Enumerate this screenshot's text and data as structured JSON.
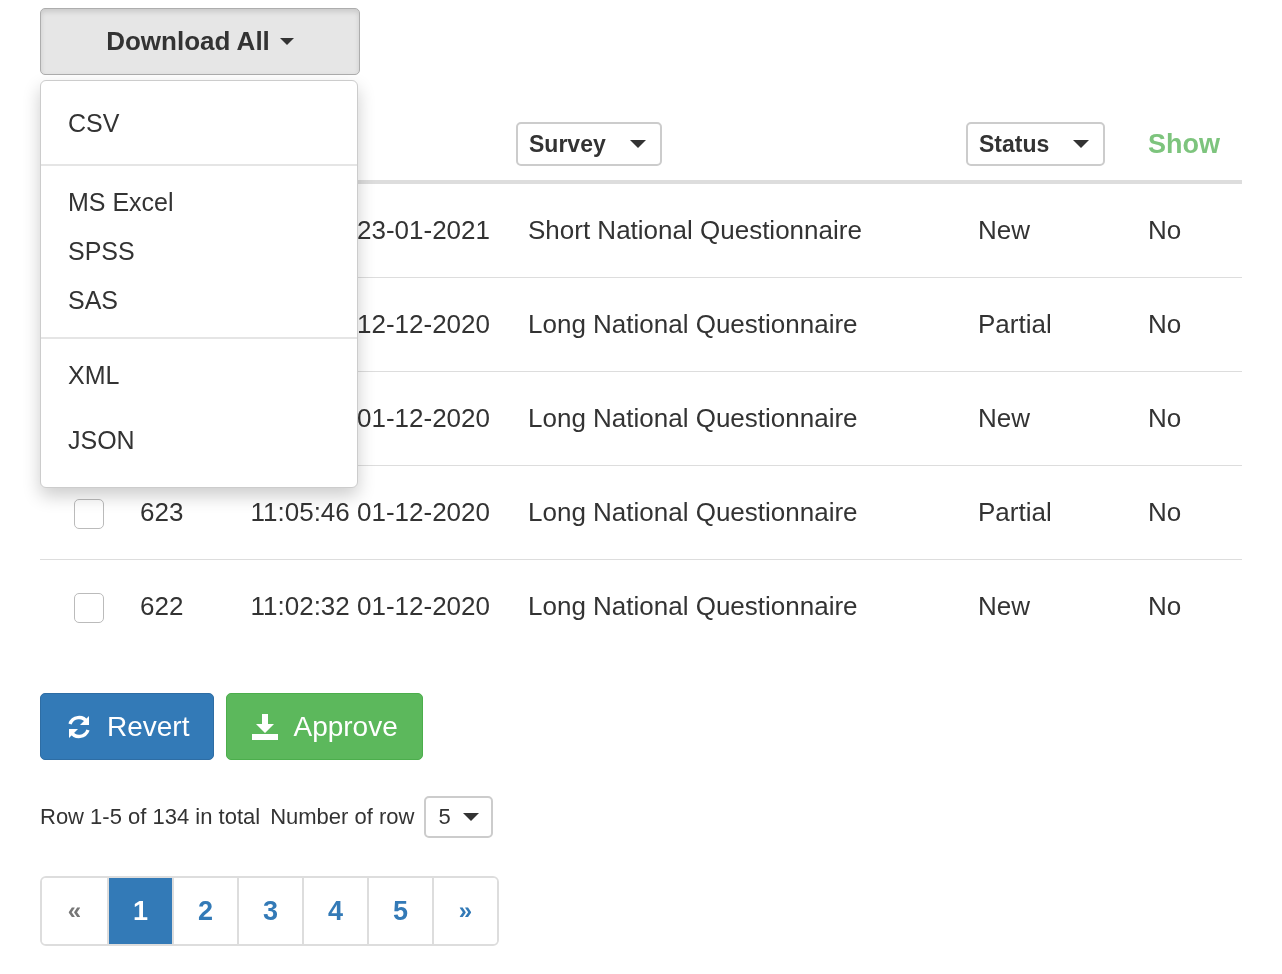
{
  "download_button": {
    "label": "Download All",
    "expanded": true
  },
  "download_menu": {
    "groups": [
      [
        "CSV"
      ],
      [
        "MS Excel",
        "SPSS",
        "SAS"
      ],
      [
        "XML",
        "JSON"
      ]
    ]
  },
  "table": {
    "headers": [
      {
        "kind": "dropdown",
        "label": "Survey"
      },
      {
        "kind": "dropdown",
        "label": "Status"
      },
      {
        "kind": "text",
        "label": "Show"
      }
    ],
    "rows": [
      {
        "datetime": "23-01-2021",
        "survey": "Short National Questionnaire",
        "status": "New",
        "show": "No"
      },
      {
        "datetime": "12-12-2020",
        "survey": "Long National Questionnaire",
        "status": "Partial",
        "show": "No"
      },
      {
        "datetime": "01-12-2020",
        "survey": "Long National Questionnaire",
        "status": "New",
        "show": "No"
      },
      {
        "checked": false,
        "id": "623",
        "datetime": "11:05:46 01-12-2020",
        "survey": "Long National Questionnaire",
        "status": "Partial",
        "show": "No"
      },
      {
        "checked": false,
        "id": "622",
        "datetime": "11:02:32 01-12-2020",
        "survey": "Long National Questionnaire",
        "status": "New",
        "show": "No"
      }
    ]
  },
  "actions": [
    {
      "kind": "revert",
      "label": "Revert"
    },
    {
      "kind": "approve",
      "label": "Approve"
    }
  ],
  "summary": "Row 1-5 of 134 in total",
  "rows_per_page": {
    "label": "Number of row",
    "value": "5"
  },
  "pagination": [
    {
      "label": "«",
      "selected": false
    },
    {
      "label": "1",
      "selected": true
    },
    {
      "label": "2",
      "selected": false
    },
    {
      "label": "3",
      "selected": false
    },
    {
      "label": "4",
      "selected": false
    },
    {
      "label": "5",
      "selected": false
    },
    {
      "label": "»",
      "selected": false
    }
  ]
}
